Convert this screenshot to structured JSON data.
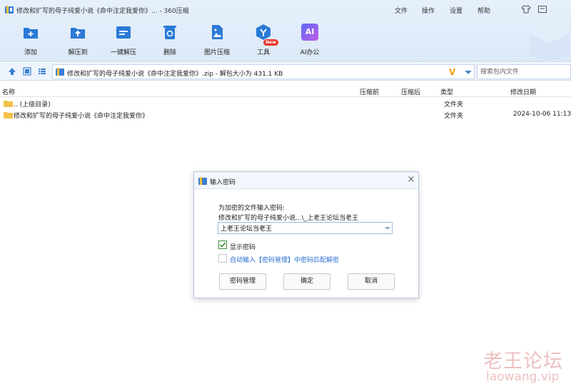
{
  "window": {
    "title": "修改和扩写的母子纯爱小说《命中注定我爱你》... - 360压缩",
    "menu": [
      "文件",
      "操作",
      "设置",
      "帮助"
    ]
  },
  "toolbar": {
    "items": [
      {
        "label": "添加",
        "icon": "add-icon"
      },
      {
        "label": "解压到",
        "icon": "extract-to-icon"
      },
      {
        "label": "一键解压",
        "icon": "one-click-extract-icon"
      },
      {
        "label": "删除",
        "icon": "delete-icon"
      },
      {
        "label": "图片压缩",
        "icon": "image-compress-icon"
      },
      {
        "label": "工具",
        "icon": "tools-icon"
      },
      {
        "label": "AI办公",
        "icon": "ai-office-icon"
      }
    ],
    "new_badge": "New",
    "ai_icon_text": "AI"
  },
  "address": {
    "path": "修改和扩写的母子纯爱小说《命中注定我爱你》.zip - 解包大小为 431.1 KB",
    "v_mark": "V",
    "search_placeholder": "搜索包内文件"
  },
  "columns": [
    "名称",
    "压缩前",
    "压缩后",
    "类型",
    "修改日期"
  ],
  "rows": [
    {
      "name": ".. (上级目录)",
      "before": "",
      "after": "",
      "type": "文件夹",
      "date": ""
    },
    {
      "name": "修改和扩写的母子纯爱小说《命中注定我爱你》",
      "before": "",
      "after": "",
      "type": "文件夹",
      "date": "2024-10-06 11:13"
    }
  ],
  "dialog": {
    "title": "输入密码",
    "prompt": "为加密的文件输入密码:",
    "file": "修改和扩写的母子纯爱小说...\\_上老王论坛当老王",
    "password_value": "上老王论坛当老王",
    "show_password_label": "显示密码",
    "show_password_checked": true,
    "auto_fill_label": "自动输入【密码管理】中密码匹配解密",
    "auto_fill_checked": false,
    "buttons": {
      "manage": "密码管理",
      "ok": "确定",
      "cancel": "取消"
    }
  },
  "watermark": {
    "cn": "老王论坛",
    "en": "laowang.vip"
  },
  "colors": {
    "accent": "#2a7ad6",
    "header_bg": "#e6f0fc",
    "link": "#2a6fd0",
    "folder": "#f4c24b"
  }
}
